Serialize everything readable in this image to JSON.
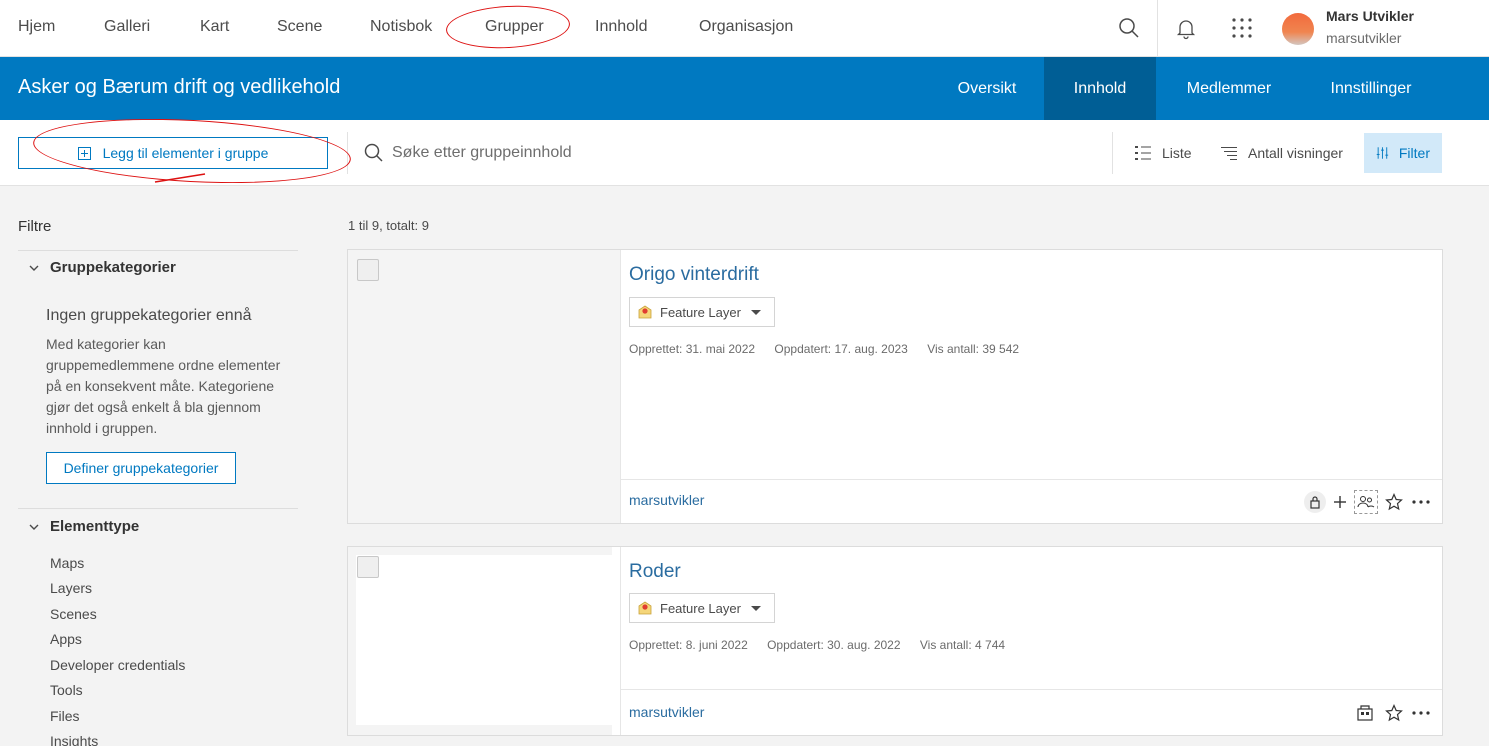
{
  "topnav": {
    "items": [
      "Hjem",
      "Galleri",
      "Kart",
      "Scene",
      "Notisbok",
      "Grupper",
      "Innhold",
      "Organisasjon"
    ],
    "user": {
      "name": "Mars Utvikler",
      "handle": "marsutvikler"
    },
    "icons": [
      "search-icon",
      "bell-icon",
      "app-launcher-icon"
    ]
  },
  "group": {
    "title": "Asker og Bærum drift og vedlikehold",
    "tabs": [
      "Oversikt",
      "Innhold",
      "Medlemmer",
      "Innstillinger"
    ],
    "active_tab": "Innhold"
  },
  "toolbar": {
    "add_label": "Legg til elementer i gruppe",
    "search_placeholder": "Søke etter gruppeinnhold",
    "view_label": "Liste",
    "sort_label": "Antall visninger",
    "filter_label": "Filter"
  },
  "sidebar": {
    "title": "Filtre",
    "categories": {
      "heading": "Gruppekategorier",
      "empty_title": "Ingen gruppekategorier ennå",
      "empty_text": "Med kategorier kan gruppemedlemmene ordne elementer på en konsekvent måte. Kategoriene gjør det også enkelt å bla gjennom innhold i gruppen.",
      "define_label": "Definer gruppekategorier"
    },
    "types": {
      "heading": "Elementtype",
      "items": [
        "Maps",
        "Layers",
        "Scenes",
        "Apps",
        "Developer credentials",
        "Tools",
        "Files",
        "Insights"
      ]
    }
  },
  "results": {
    "count": "1 til 9, totalt: 9",
    "items": [
      {
        "title": "Origo vinterdrift",
        "type": "Feature Layer",
        "created": "Opprettet: 31. mai 2022",
        "updated": "Oppdatert: 17. aug. 2023",
        "views": "Vis antall: 39 542",
        "owner": "marsutvikler"
      },
      {
        "title": "Roder",
        "type": "Feature Layer",
        "created": "Opprettet: 8. juni 2022",
        "updated": "Oppdatert: 30. aug. 2022",
        "views": "Vis antall: 4 744",
        "owner": "marsutvikler"
      }
    ]
  },
  "colors": {
    "brand": "#0079c1",
    "header_active": "#005e95",
    "annotation": "#dd1111"
  }
}
